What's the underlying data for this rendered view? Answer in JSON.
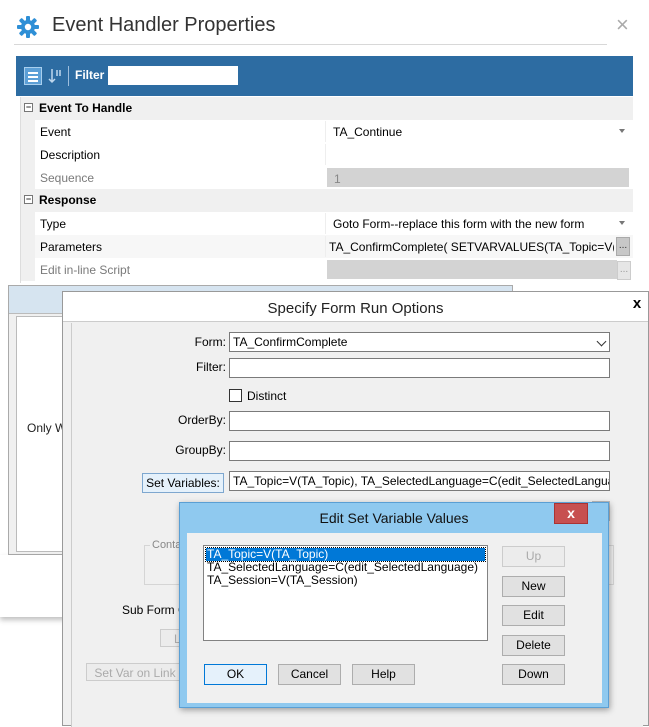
{
  "event_handler": {
    "title": "Event Handler Properties",
    "close_glyph": "×",
    "toolbar": {
      "filter_label": "Filter",
      "filter_value": ""
    },
    "categories": [
      {
        "label": "Event To Handle",
        "expander": "⊟"
      },
      {
        "label": "Response",
        "expander": "⊟"
      }
    ],
    "rows": [
      {
        "name": "Event",
        "value": "TA_Continue"
      },
      {
        "name": "Description",
        "value": ""
      },
      {
        "name": "Sequence",
        "value": "1"
      },
      {
        "name": "Type",
        "value": "Goto Form--replace this form with the new form"
      },
      {
        "name": "Parameters",
        "value": "TA_ConfirmComplete( SETVARVALUES(TA_Topic=V("
      },
      {
        "name": "Edit in-line Script",
        "value": ""
      }
    ],
    "ellipsis": "..."
  },
  "background_dialog": {
    "partial_text": "Only W"
  },
  "form_run_options": {
    "title": "Specify Form Run Options",
    "close_glyph": "x",
    "form_label": "Form:",
    "form_value": "TA_ConfirmComplete",
    "filter_label": "Filter:",
    "filter_value": "",
    "distinct_label": "Distinct",
    "orderby_label": "OrderBy:",
    "orderby_value": "",
    "groupby_label": "GroupBy:",
    "groupby_value": "",
    "set_variables_button": "Set Variables:",
    "set_variables_value": "TA_Topic=V(TA_Topic), TA_SelectedLanguage=C(edit_SelectedLanguage), T.",
    "container_label_partial": "Contai",
    "sub_form_label_partial": "Sub Form C",
    "l_button_partial": "L",
    "set_var_on_link_button": "Set Var on Link U"
  },
  "edit_set_variables": {
    "title": "Edit Set Variable Values",
    "close_glyph": "x",
    "items": [
      "TA_Topic=V(TA_Topic)",
      "TA_SelectedLanguage=C(edit_SelectedLanguage)",
      "TA_Session=V(TA_Session)"
    ],
    "buttons": {
      "up": "Up",
      "new": "New",
      "edit": "Edit",
      "delete": "Delete",
      "down": "Down",
      "ok": "OK",
      "cancel": "Cancel",
      "help": "Help"
    }
  },
  "colors": {
    "toolbar_bg": "#2d6ca2",
    "gear_icon": "#2e8fd6",
    "dialog_title_bg": "#8fc9ef",
    "close_red": "#c75050",
    "selection": "#0078d7"
  }
}
